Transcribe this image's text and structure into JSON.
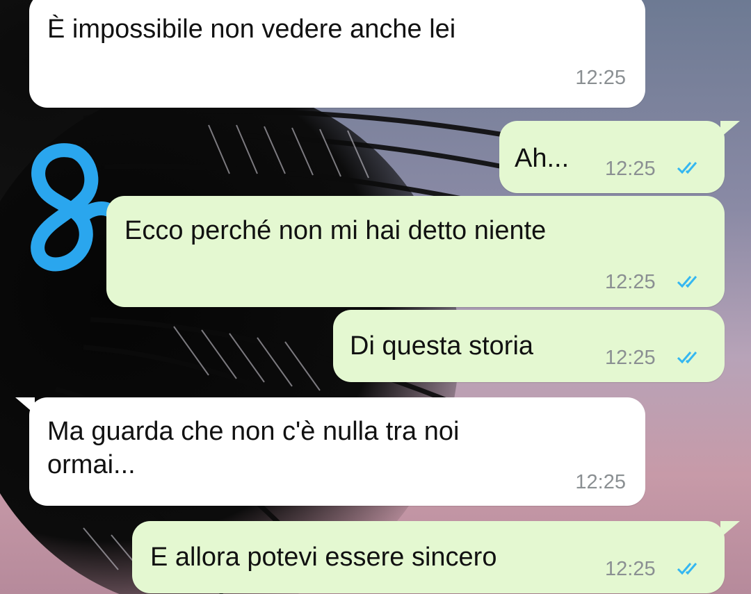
{
  "messages": [
    {
      "direction": "incoming",
      "text": "È impossibile non vedere anche lei",
      "time": "12:25"
    },
    {
      "direction": "outgoing",
      "text": "Ah...",
      "time": "12:25",
      "status": "read-double-check"
    },
    {
      "direction": "outgoing",
      "text": "Ecco perché non mi hai detto niente",
      "time": "12:25",
      "status": "read-double-check"
    },
    {
      "direction": "outgoing",
      "text": "Di questa storia",
      "time": "12:25",
      "status": "read-double-check"
    },
    {
      "direction": "incoming",
      "text": "Ma guarda che non c'è nulla tra noi\normai...",
      "time": "12:25"
    },
    {
      "direction": "outgoing",
      "text": "E allora potevi essere sincero",
      "time": "12:25",
      "status": "read-double-check"
    }
  ],
  "colors": {
    "incoming_bubble": "#ffffff",
    "outgoing_bubble": "#e4f8d1",
    "read_ticks": "#34b7f1",
    "doodle": "#2aa6ee"
  },
  "icons": {
    "read_status": "double-check-icon",
    "annotation": "handwritten-8-scribble"
  }
}
